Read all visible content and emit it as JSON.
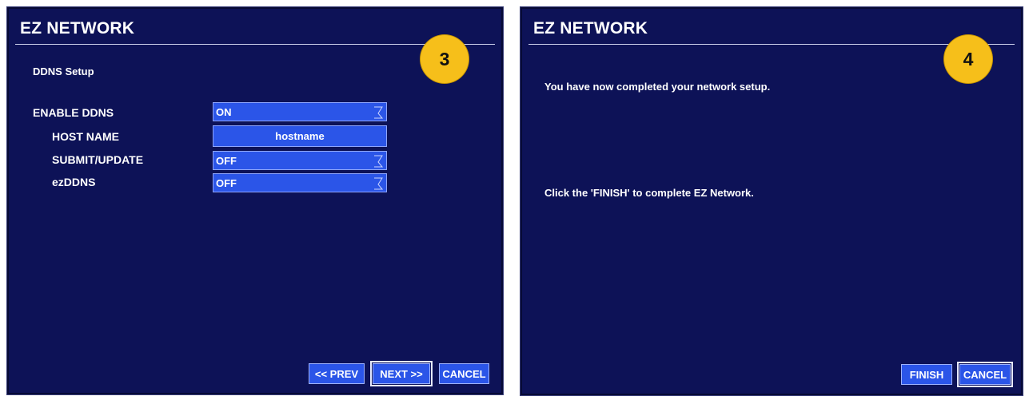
{
  "colors": {
    "panel_bg": "#0d1257",
    "control_bg": "#2b55e8",
    "badge_bg": "#f6bf1a",
    "text": "#ffffff"
  },
  "step3": {
    "title": "EZ NETWORK",
    "step_badge": "3",
    "section_title": "DDNS Setup",
    "rows": [
      {
        "label": "ENABLE DDNS",
        "value": "ON",
        "control": "dropdown",
        "icon": "dropdown-arrow-icon"
      },
      {
        "label": "HOST NAME",
        "value": "hostname",
        "control": "text"
      },
      {
        "label": "SUBMIT/UPDATE",
        "value": "OFF",
        "control": "dropdown",
        "icon": "dropdown-arrow-icon"
      },
      {
        "label": "ezDDNS",
        "value": "OFF",
        "control": "dropdown",
        "icon": "dropdown-arrow-icon"
      }
    ],
    "buttons": {
      "prev": "<< PREV",
      "next": "NEXT >>",
      "cancel": "CANCEL"
    }
  },
  "step4": {
    "title": "EZ NETWORK",
    "step_badge": "4",
    "message_1": "You have now completed your network setup.",
    "message_2": "Click the 'FINISH' to complete EZ Network.",
    "buttons": {
      "finish": "FINISH",
      "cancel": "CANCEL"
    }
  }
}
